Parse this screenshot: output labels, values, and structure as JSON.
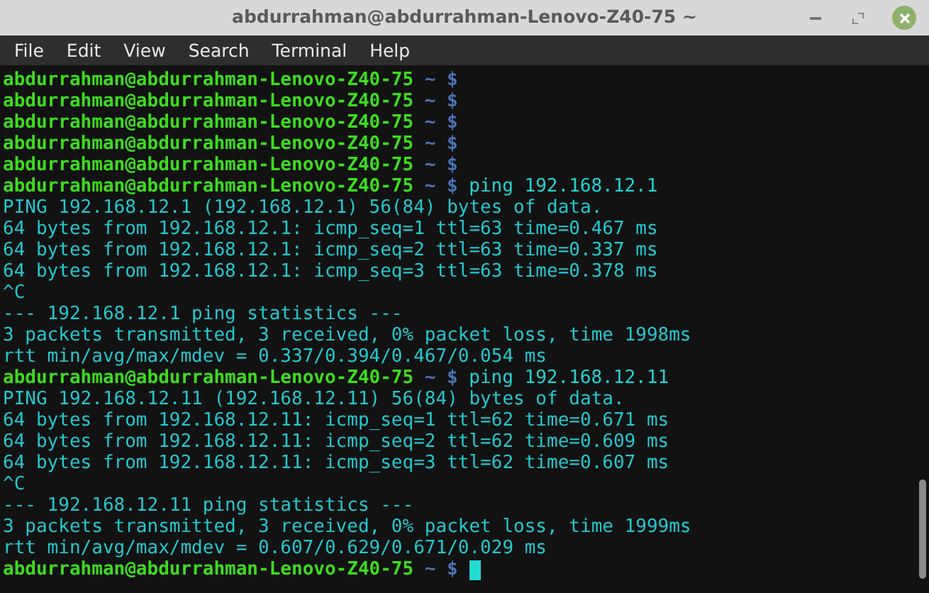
{
  "window": {
    "title": "abdurrahman@abdurrahman-Lenovo-Z40-75 ~"
  },
  "menu": [
    "File",
    "Edit",
    "View",
    "Search",
    "Terminal",
    "Help"
  ],
  "lines": [
    {
      "kind": "prompt",
      "user": "abdurrahman@abdurrahman-Lenovo-Z40-75",
      "dir": "~",
      "symbol": "$",
      "cursor": false
    },
    {
      "kind": "prompt",
      "user": "abdurrahman@abdurrahman-Lenovo-Z40-75",
      "dir": "~",
      "symbol": "$",
      "cursor": false
    },
    {
      "kind": "prompt",
      "user": "abdurrahman@abdurrahman-Lenovo-Z40-75",
      "dir": "~",
      "symbol": "$",
      "cursor": false
    },
    {
      "kind": "prompt",
      "user": "abdurrahman@abdurrahman-Lenovo-Z40-75",
      "dir": "~",
      "symbol": "$",
      "cursor": false
    },
    {
      "kind": "prompt",
      "user": "abdurrahman@abdurrahman-Lenovo-Z40-75",
      "dir": "~",
      "symbol": "$",
      "cursor": false
    },
    {
      "kind": "prompt",
      "user": "abdurrahman@abdurrahman-Lenovo-Z40-75",
      "dir": "~",
      "symbol": "$",
      "command": "ping 192.168.12.1",
      "cursor": false
    },
    {
      "kind": "output",
      "text": "PING 192.168.12.1 (192.168.12.1) 56(84) bytes of data."
    },
    {
      "kind": "output",
      "text": "64 bytes from 192.168.12.1: icmp_seq=1 ttl=63 time=0.467 ms"
    },
    {
      "kind": "output",
      "text": "64 bytes from 192.168.12.1: icmp_seq=2 ttl=63 time=0.337 ms"
    },
    {
      "kind": "output",
      "text": "64 bytes from 192.168.12.1: icmp_seq=3 ttl=63 time=0.378 ms"
    },
    {
      "kind": "output",
      "text": "^C"
    },
    {
      "kind": "output",
      "text": "--- 192.168.12.1 ping statistics ---"
    },
    {
      "kind": "output",
      "text": "3 packets transmitted, 3 received, 0% packet loss, time 1998ms"
    },
    {
      "kind": "output",
      "text": "rtt min/avg/max/mdev = 0.337/0.394/0.467/0.054 ms"
    },
    {
      "kind": "prompt",
      "user": "abdurrahman@abdurrahman-Lenovo-Z40-75",
      "dir": "~",
      "symbol": "$",
      "command": "ping 192.168.12.11",
      "cursor": false
    },
    {
      "kind": "output",
      "text": "PING 192.168.12.11 (192.168.12.11) 56(84) bytes of data."
    },
    {
      "kind": "output",
      "text": "64 bytes from 192.168.12.11: icmp_seq=1 ttl=62 time=0.671 ms"
    },
    {
      "kind": "output",
      "text": "64 bytes from 192.168.12.11: icmp_seq=2 ttl=62 time=0.609 ms"
    },
    {
      "kind": "output",
      "text": "64 bytes from 192.168.12.11: icmp_seq=3 ttl=62 time=0.607 ms"
    },
    {
      "kind": "output",
      "text": "^C"
    },
    {
      "kind": "output",
      "text": "--- 192.168.12.11 ping statistics ---"
    },
    {
      "kind": "output",
      "text": "3 packets transmitted, 3 received, 0% packet loss, time 1999ms"
    },
    {
      "kind": "output",
      "text": "rtt min/avg/max/mdev = 0.607/0.629/0.671/0.029 ms"
    },
    {
      "kind": "prompt",
      "user": "abdurrahman@abdurrahman-Lenovo-Z40-75",
      "dir": "~",
      "symbol": "$",
      "cursor": true
    }
  ]
}
